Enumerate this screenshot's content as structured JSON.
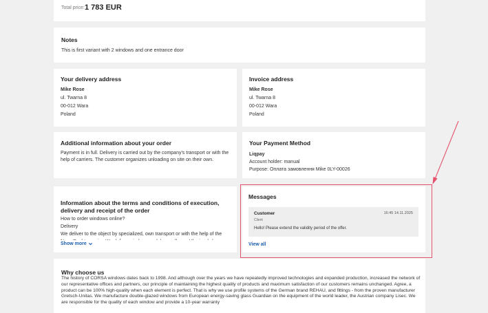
{
  "total": {
    "label": "Total price:",
    "value": "1 783 EUR"
  },
  "notes": {
    "title": "Notes",
    "text": "This is first variant with 2 windows and one entrance door"
  },
  "delivery": {
    "title": "Your delivery address",
    "name": "Mike Rose",
    "street": "ul. Twarna 8",
    "city": "00-012 Wara",
    "country": "Poland"
  },
  "invoice": {
    "title": "Invoice address",
    "name": "Mike Rose",
    "street": "ul. Twarna 8",
    "city": "00-012 Wara",
    "country": "Poland"
  },
  "additional": {
    "title": "Additional information about your order",
    "text": "Payment is in full. Delivery is carried out by the company's transport or with the help of carriers. The customer organizes unloading on site on their own."
  },
  "payment": {
    "title": "Your Payment Method",
    "method": "Liqpay",
    "holder": "Account holder: manual",
    "purpose": "Purpose: Оплата замовлення Mike 0LY-00026"
  },
  "terms": {
    "title": "Information about the terms and conditions of execution, delivery and receipt of the order",
    "line1": "How to order windows online?",
    "line2": "Delivery",
    "line3": "We deliver to the object by specialized, own transport or with the help of the Nova Poshta carrier. We deliver windows and doors all over Ukraine (where",
    "show_more": "Show more"
  },
  "messages": {
    "title": "Messages",
    "item": {
      "sender": "Customer",
      "role": "Client",
      "time": "16:45 14.11.2025",
      "text": "Hello! Please extend the validity period of the offer."
    },
    "view_all": "View all"
  },
  "why": {
    "title": "Why choose us",
    "text": "The history of CORSA windows dates back to 1998. And although over the years we have repeatedly improved technologies and expanded production, increased the network of our representative offices and partners, our principle of maintaining the highest quality of products and maximum satisfaction of our customers remains unchanged. Agree, a product can be 100% high-quality when each element is perfect. That is why we use profile systems of the German brand REHAU, and fittings - from the proven manufacturer Gretsch-Unitas. We manufacture double-glazed windows from European energy-saving glass Guardian on the equipment of the world leader, the Austrian company Lisec. We are responsible for the quality of each window and provide a 10-year warranty"
  },
  "colors": {
    "link": "#1c5fae",
    "annotation": "#e5506b",
    "page_bg": "#f0f0f0"
  }
}
